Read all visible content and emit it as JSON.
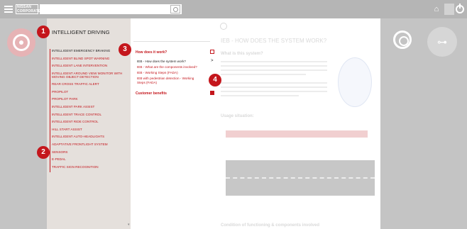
{
  "topbar": {
    "brand": "NISSAN\nCORPORATE",
    "search_placeholder": "",
    "icons": [
      "menu-icon",
      "search-icon",
      "home-icon",
      "help-icon",
      "power-icon"
    ],
    "help_label": "?"
  },
  "sidebar": {
    "header": "INTELLIGENT DRIVING",
    "items": [
      {
        "label": "INTELLIGENT EMERGENCY BRAKING",
        "active": true
      },
      {
        "label": "INTELLIGENT BLIND SPOT WARNING",
        "active": false
      },
      {
        "label": "INTELLIGENT LANE INTERVENTION",
        "active": false
      },
      {
        "label": "INTELLIGENT AROUND VIEW MONITOR WITH MOVING OBJECT DETECTION",
        "active": false
      },
      {
        "label": "REAR CROSS TRAFFIC ALERT",
        "active": false
      },
      {
        "label": "PROPILOT",
        "active": false
      },
      {
        "label": "PROPILOT PARK",
        "active": false
      },
      {
        "label": "INTELLIGENT PARK ASSIST",
        "active": false
      },
      {
        "label": "INTELLIGENT TRACE CONTROL",
        "active": false
      },
      {
        "label": "INTELLIGENT RIDE CONTROL",
        "active": false
      },
      {
        "label": "HILL START ASSIST",
        "active": false
      },
      {
        "label": "INTELLIGENT AUTO-HEADLIGHTS",
        "active": false
      },
      {
        "label": "ADAPTATIVE FRONTLIGHT SYSTEM",
        "active": false
      },
      {
        "label": "SENSORS",
        "active": false
      },
      {
        "label": "E-PEDAL",
        "active": false
      },
      {
        "label": "TRAFFIC SIGN RECOGNITION",
        "active": false
      }
    ]
  },
  "middle": {
    "section1": "How does it work?",
    "links": [
      {
        "label": "IEB - How does the system work?",
        "current": true
      },
      {
        "label": "IEB - What are the components involved?",
        "current": false
      },
      {
        "label": "IEB - Working Steps (FADA)",
        "current": false
      },
      {
        "label": "IEB with pedestrian detection - Working Steps (FADA)",
        "current": false
      }
    ],
    "arrow": ">",
    "section2": "Customer benefits"
  },
  "content": {
    "title": "IEB - HOW DOES THE SYSTEM WORK?",
    "subtitle": "What is this system?",
    "usage": "Usage situation:",
    "footer": "Condition of functioning & components involved"
  },
  "markers": [
    "1",
    "2",
    "3",
    "4"
  ],
  "colors": {
    "accent": "#c4161c",
    "sidebar_bg": "#e5e0dc",
    "shade": "#c4c4c4"
  }
}
